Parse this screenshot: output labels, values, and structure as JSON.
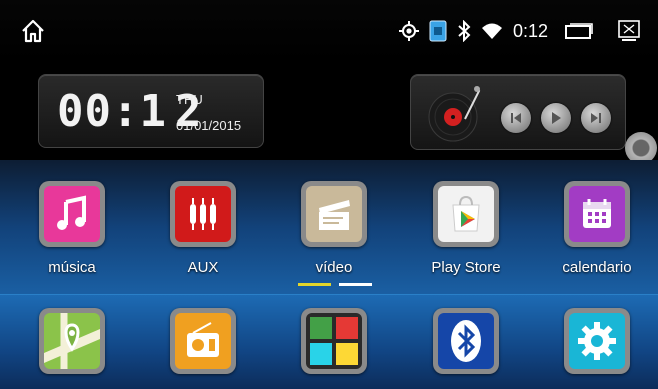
{
  "statusbar": {
    "time": "0:12",
    "icons": [
      "home-icon",
      "gps-icon",
      "sim-icon",
      "bluetooth-icon",
      "wifi-icon",
      "recent-apps-icon",
      "screenshot-icon"
    ]
  },
  "clock_widget": {
    "time": "00:12",
    "day": "THU",
    "date": "01/01/2015"
  },
  "media_widget": {
    "buttons": [
      "previous-icon",
      "play-icon",
      "next-icon"
    ]
  },
  "apps_row1": [
    {
      "label": "música",
      "icon": "music-icon",
      "color": "#e8389a"
    },
    {
      "label": "AUX",
      "icon": "aux-icon",
      "color": "#d11a1a"
    },
    {
      "label": "vídeo",
      "icon": "video-icon",
      "color": "#c9b99a"
    },
    {
      "label": "Play Store",
      "icon": "play-store-icon",
      "color": "#f2f2f2"
    },
    {
      "label": "calendario",
      "icon": "calendar-icon",
      "color": "#a23cc4"
    }
  ],
  "apps_row2": [
    {
      "label": "",
      "icon": "maps-icon",
      "color": "#8bc34a"
    },
    {
      "label": "",
      "icon": "radio-icon",
      "color": "#f0a020"
    },
    {
      "label": "",
      "icon": "apps-grid-icon",
      "color": "#2a2a2a"
    },
    {
      "label": "",
      "icon": "bluetooth-app-icon",
      "color": "#1546a8"
    },
    {
      "label": "",
      "icon": "settings-icon",
      "color": "#19b6d6"
    }
  ],
  "colors": {
    "accent_blue": "#1a5fa3",
    "page_indicator_active": "#e3d52a"
  }
}
